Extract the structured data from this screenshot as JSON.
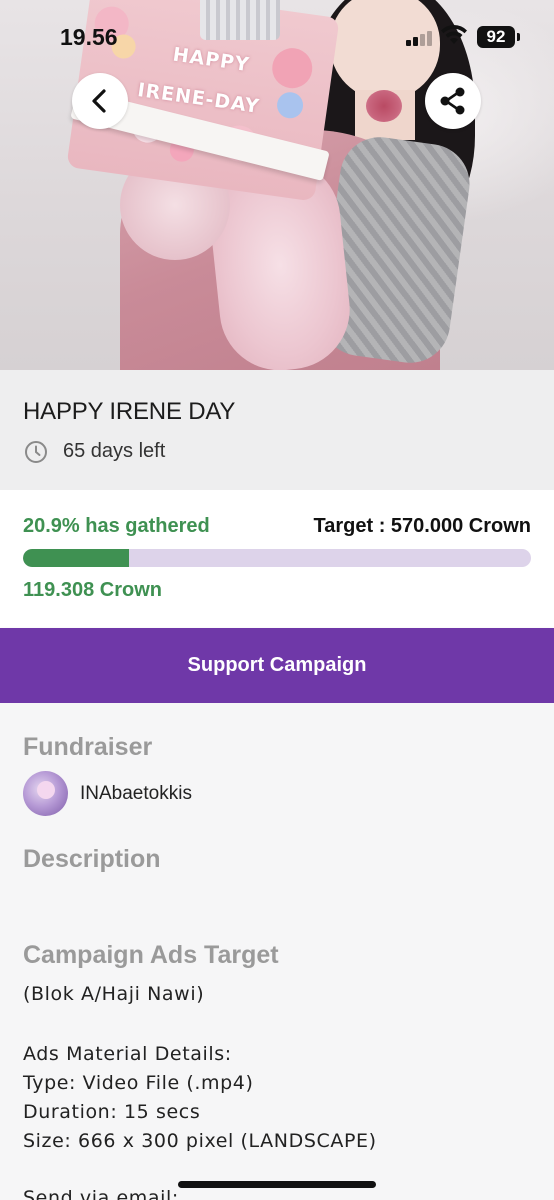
{
  "status_bar": {
    "time": "19.56",
    "battery": "92"
  },
  "hero": {
    "cake_line1": "HAPPY",
    "cake_line2": "IRENE-DAY"
  },
  "campaign": {
    "title": "HAPPY IRENE DAY",
    "days_left": "65 days left",
    "gathered_label": "20.9% has gathered",
    "gathered_fraction": 0.209,
    "target_label": "Target : 570.000 Crown",
    "collected_amount": "119.308 Crown",
    "support_button": "Support Campaign"
  },
  "fundraiser": {
    "heading": "Fundraiser",
    "name": "INAbaetokkis"
  },
  "description": {
    "heading": "Description"
  },
  "ads_target": {
    "heading": "Campaign Ads Target",
    "location": "(Blok A/Haji Nawi)",
    "details_heading": "Ads Material Details:",
    "type": "Type: Video File (.mp4)",
    "duration": "Duration: 15 secs",
    "size": "Size: 666 x 300 pixel (LANDSCAPE)",
    "send_via": "Send via email:"
  },
  "icons": {
    "back": "chevron-left-icon",
    "share": "share-icon",
    "clock": "clock-icon",
    "signal": "cellular-signal-icon",
    "wifi": "wifi-icon",
    "battery": "battery-icon"
  },
  "colors": {
    "accent_purple": "#6f38a8",
    "progress_green": "#3f9152",
    "progress_track": "#ddd3ea",
    "heading_gray": "#9a9a9a"
  }
}
